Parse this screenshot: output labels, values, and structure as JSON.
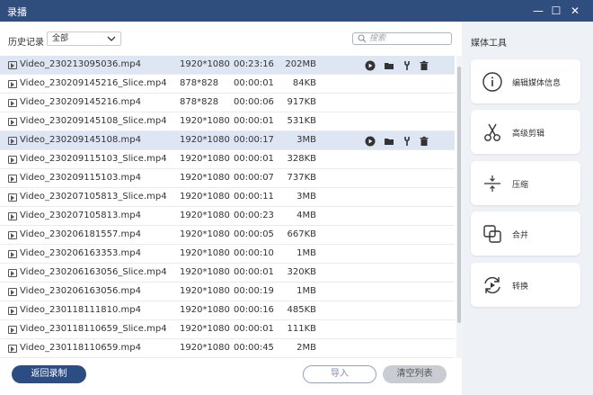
{
  "window": {
    "title": "录播",
    "minimize": "—",
    "maximize": "☐",
    "close": "✕"
  },
  "history": {
    "label": "历史记录",
    "filter_value": "全部",
    "search_placeholder": "搜索"
  },
  "files": [
    {
      "name": "Video_230213095036.mp4",
      "resolution": "1920*1080",
      "duration": "00:23:16",
      "size": "202MB",
      "selected": true
    },
    {
      "name": "Video_230209145216_Slice.mp4",
      "resolution": "878*828",
      "duration": "00:00:01",
      "size": "84KB",
      "selected": false
    },
    {
      "name": "Video_230209145216.mp4",
      "resolution": "878*828",
      "duration": "00:00:06",
      "size": "917KB",
      "selected": false
    },
    {
      "name": "Video_230209145108_Slice.mp4",
      "resolution": "1920*1080",
      "duration": "00:00:01",
      "size": "531KB",
      "selected": false
    },
    {
      "name": "Video_230209145108.mp4",
      "resolution": "1920*1080",
      "duration": "00:00:17",
      "size": "3MB",
      "selected": true
    },
    {
      "name": "Video_230209115103_Slice.mp4",
      "resolution": "1920*1080",
      "duration": "00:00:01",
      "size": "328KB",
      "selected": false
    },
    {
      "name": "Video_230209115103.mp4",
      "resolution": "1920*1080",
      "duration": "00:00:07",
      "size": "737KB",
      "selected": false
    },
    {
      "name": "Video_230207105813_Slice.mp4",
      "resolution": "1920*1080",
      "duration": "00:00:11",
      "size": "3MB",
      "selected": false
    },
    {
      "name": "Video_230207105813.mp4",
      "resolution": "1920*1080",
      "duration": "00:00:23",
      "size": "4MB",
      "selected": false
    },
    {
      "name": "Video_230206181557.mp4",
      "resolution": "1920*1080",
      "duration": "00:00:05",
      "size": "667KB",
      "selected": false
    },
    {
      "name": "Video_230206163353.mp4",
      "resolution": "1920*1080",
      "duration": "00:00:10",
      "size": "1MB",
      "selected": false
    },
    {
      "name": "Video_230206163056_Slice.mp4",
      "resolution": "1920*1080",
      "duration": "00:00:01",
      "size": "320KB",
      "selected": false
    },
    {
      "name": "Video_230206163056.mp4",
      "resolution": "1920*1080",
      "duration": "00:00:19",
      "size": "1MB",
      "selected": false
    },
    {
      "name": "Video_230118111810.mp4",
      "resolution": "1920*1080",
      "duration": "00:00:16",
      "size": "485KB",
      "selected": false
    },
    {
      "name": "Video_230118110659_Slice.mp4",
      "resolution": "1920*1080",
      "duration": "00:00:01",
      "size": "111KB",
      "selected": false
    },
    {
      "name": "Video_230118110659.mp4",
      "resolution": "1920*1080",
      "duration": "00:00:45",
      "size": "2MB",
      "selected": false
    }
  ],
  "row_actions": [
    "play-icon",
    "folder-icon",
    "tools-icon",
    "trash-icon"
  ],
  "footer": {
    "back_label": "返回录制",
    "import_label": "导入",
    "clear_label": "清空列表"
  },
  "tools": {
    "title": "媒体工具",
    "items": [
      {
        "id": "media-info",
        "label": "编辑媒体信息",
        "icon": "info-icon"
      },
      {
        "id": "advanced-cut",
        "label": "高级剪辑",
        "icon": "scissors-icon"
      },
      {
        "id": "compress",
        "label": "压缩",
        "icon": "compress-icon"
      },
      {
        "id": "merge",
        "label": "合并",
        "icon": "merge-icon"
      },
      {
        "id": "convert",
        "label": "转换",
        "icon": "convert-icon"
      }
    ]
  },
  "colors": {
    "titlebar": "#2f4e7e",
    "accent": "#2c4d82",
    "selected_row": "#dfe6f3",
    "panel_bg": "#eef1f6"
  }
}
